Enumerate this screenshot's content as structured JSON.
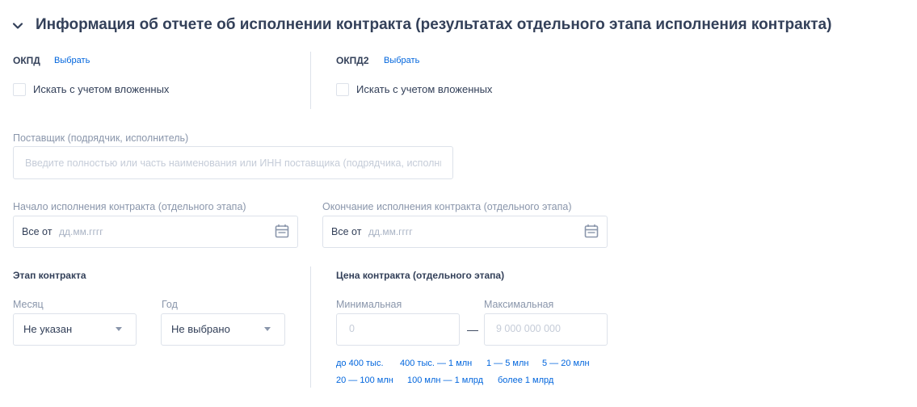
{
  "section": {
    "title": "Информация об отчете об исполнении контракта (результатах отдельного этапа исполнения контракта)"
  },
  "okpd": {
    "label": "ОКПД",
    "select_link": "Выбрать",
    "nested_label": "Искать с учетом вложенных"
  },
  "okpd2": {
    "label": "ОКПД2",
    "select_link": "Выбрать",
    "nested_label": "Искать с учетом вложенных"
  },
  "supplier": {
    "label": "Поставщик (подрядчик, исполнитель)",
    "placeholder": "Введите полностью или часть наименования или ИНН поставщика (подрядчика, исполнителя)"
  },
  "start_date": {
    "label": "Начало исполнения контракта (отдельного этапа)",
    "prefix": "Все от",
    "placeholder": "дд.мм.гггг"
  },
  "end_date": {
    "label": "Окончание исполнения контракта (отдельного этапа)",
    "prefix": "Все от",
    "placeholder": "дд.мм.гггг"
  },
  "stage": {
    "title": "Этап контракта",
    "month_label": "Месяц",
    "month_value": "Не указан",
    "year_label": "Год",
    "year_value": "Не выбрано"
  },
  "price": {
    "title": "Цена контракта (отдельного этапа)",
    "min_label": "Минимальная",
    "min_placeholder": "0",
    "max_label": "Максимальная",
    "max_placeholder": "9 000 000 000",
    "separator": "—",
    "ranges": [
      "до 400 тыс.",
      "400 тыс. — 1 млн",
      "1 — 5 млн",
      "5 — 20 млн",
      "20 — 100 млн",
      "100 млн — 1 млрд",
      "более 1 млрд"
    ]
  },
  "colors": {
    "text": "#334059",
    "muted": "#8a96ab",
    "link": "#0065dd",
    "border": "#dde2ea"
  }
}
